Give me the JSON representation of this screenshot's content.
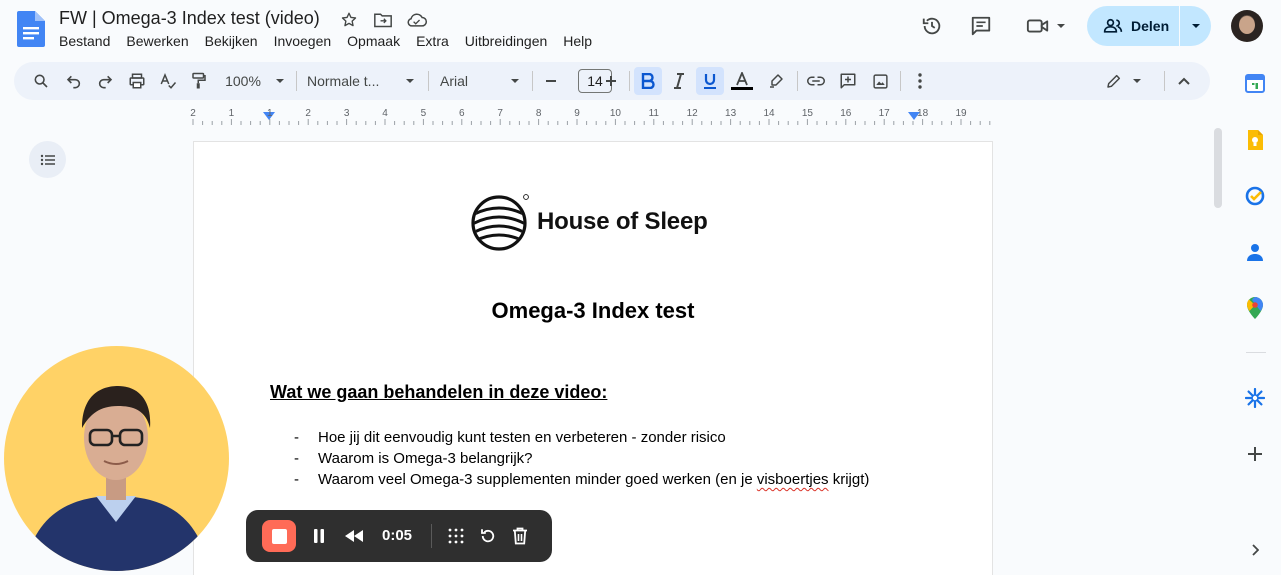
{
  "app": {
    "title": "FW | Omega-3 Index test (video)",
    "menu": [
      "Bestand",
      "Bewerken",
      "Bekijken",
      "Invoegen",
      "Opmaak",
      "Extra",
      "Uitbreidingen",
      "Help"
    ],
    "share_label": "Delen"
  },
  "toolbar": {
    "zoom": "100%",
    "style": "Normale t...",
    "font": "Arial",
    "font_size": "14"
  },
  "ruler": {
    "numbers": [
      "2",
      "1",
      "1",
      "2",
      "3",
      "4",
      "5",
      "6",
      "7",
      "8",
      "9",
      "10",
      "11",
      "12",
      "13",
      "14",
      "15",
      "16",
      "17",
      "18",
      "19"
    ]
  },
  "document": {
    "brand": "House of Sleep",
    "heading": "Omega-3 Index test",
    "subheading": "Wat we gaan behandelen in deze video:",
    "bullets": [
      {
        "text": "Hoe jij dit eenvoudig kunt testen en verbeteren - zonder risico"
      },
      {
        "text": "Waarom is Omega-3 belangrijk?"
      },
      {
        "before": "Waarom veel Omega-3 supplementen minder goed werken (en je ",
        "flagged": "visboertjes",
        "after": " krijgt)"
      }
    ]
  },
  "recorder": {
    "time": "0:05"
  },
  "colors": {
    "accent": "#c2e7ff",
    "toolbar": "#edf2fa",
    "record": "#ff6b57",
    "webcam_bg": "#ffd266"
  },
  "icons": {
    "header": [
      "star-icon",
      "move-to-folder-icon",
      "cloud-saved-icon",
      "history-icon",
      "comments-icon",
      "meet-icon"
    ],
    "side": [
      "calendar-icon",
      "keep-icon",
      "tasks-icon",
      "contacts-icon",
      "maps-icon",
      "addon-icon",
      "add-icon"
    ]
  }
}
